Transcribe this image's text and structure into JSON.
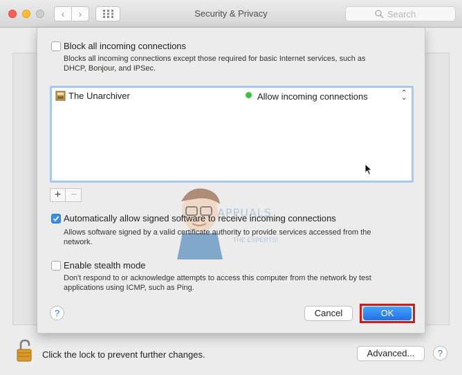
{
  "window": {
    "title": "Security & Privacy",
    "search_placeholder": "Search"
  },
  "sheet": {
    "block_all": {
      "label": "Block all incoming connections",
      "desc_line1": "Blocks all incoming connections except those required for basic Internet services,  such as",
      "desc_line2": "DHCP, Bonjour, and IPSec.",
      "checked": false
    },
    "apps": [
      {
        "name": "The Unarchiver",
        "status": "Allow incoming connections",
        "status_color": "#3fbf3a"
      }
    ],
    "auto_allow": {
      "label": "Automatically allow signed software to receive incoming connections",
      "desc_line1": "Allows software signed by a valid certificate authority to provide services accessed from the",
      "desc_line2": "network.",
      "checked": true
    },
    "stealth": {
      "label": "Enable stealth mode",
      "desc_line1": "Don't respond to or acknowledge attempts to access this computer from the network by test",
      "desc_line2": "applications using ICMP, such as Ping.",
      "checked": false
    },
    "plus": "+",
    "minus": "−",
    "help": "?",
    "cancel": "Cancel",
    "ok": "OK"
  },
  "watermark": {
    "brand": "APPUALS",
    "tagline": "THE EXPERTS!"
  },
  "footer": {
    "lock_text": "Click the lock to prevent further changes.",
    "advanced": "Advanced...",
    "help": "?"
  },
  "colors": {
    "accent": "#3b8eea",
    "ok_outline": "#d11a1a"
  }
}
